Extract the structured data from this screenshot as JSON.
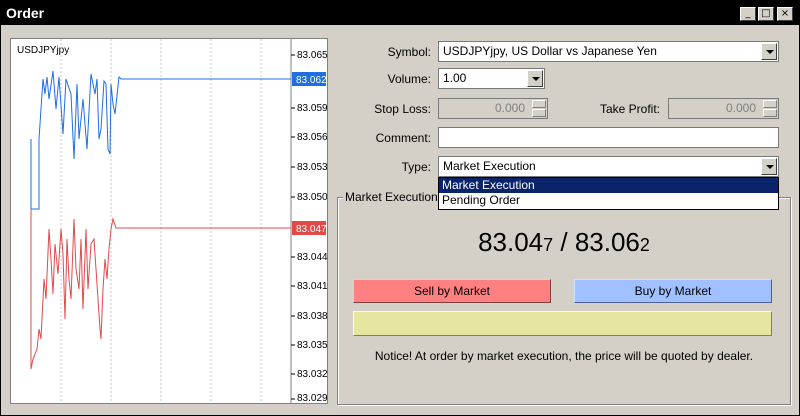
{
  "window": {
    "title": "Order",
    "buttons": [
      "_",
      "□",
      "×"
    ]
  },
  "chart": {
    "symbol": "USDJPYjpy",
    "price_ticks": [
      "83.065",
      "83.062",
      "83.059",
      "83.056",
      "83.053",
      "83.050",
      "83.047",
      "83.044",
      "83.041",
      "83.038",
      "83.035",
      "83.032",
      "83.029"
    ],
    "ask_label": "83.062",
    "bid_label": "83.047",
    "ask_color": "#1f6fe0",
    "bid_color": "#e24a4a"
  },
  "form": {
    "symbol_label": "Symbol:",
    "symbol_value": "USDJPYjpy, US Dollar vs Japanese Yen",
    "volume_label": "Volume:",
    "volume_value": "1.00",
    "stoploss_label": "Stop Loss:",
    "stoploss_value": "0.000",
    "takeprofit_label": "Take Profit:",
    "takeprofit_value": "0.000",
    "comment_label": "Comment:",
    "comment_value": "",
    "type_label": "Type:",
    "type_value": "Market Execution",
    "type_options": [
      "Market Execution",
      "Pending Order"
    ]
  },
  "market": {
    "group_title": "Market Execution",
    "bid_main": "83.04",
    "bid_last": "7",
    "separator": " / ",
    "ask_main": "83.06",
    "ask_last": "2",
    "sell_label": "Sell by Market",
    "buy_label": "Buy by Market",
    "sell_color": "#ff8080",
    "buy_color": "#a0c0ff",
    "placeholder_color": "#e6e6a0",
    "notice": "Notice! At order by market execution, the price will be quoted by dealer."
  }
}
